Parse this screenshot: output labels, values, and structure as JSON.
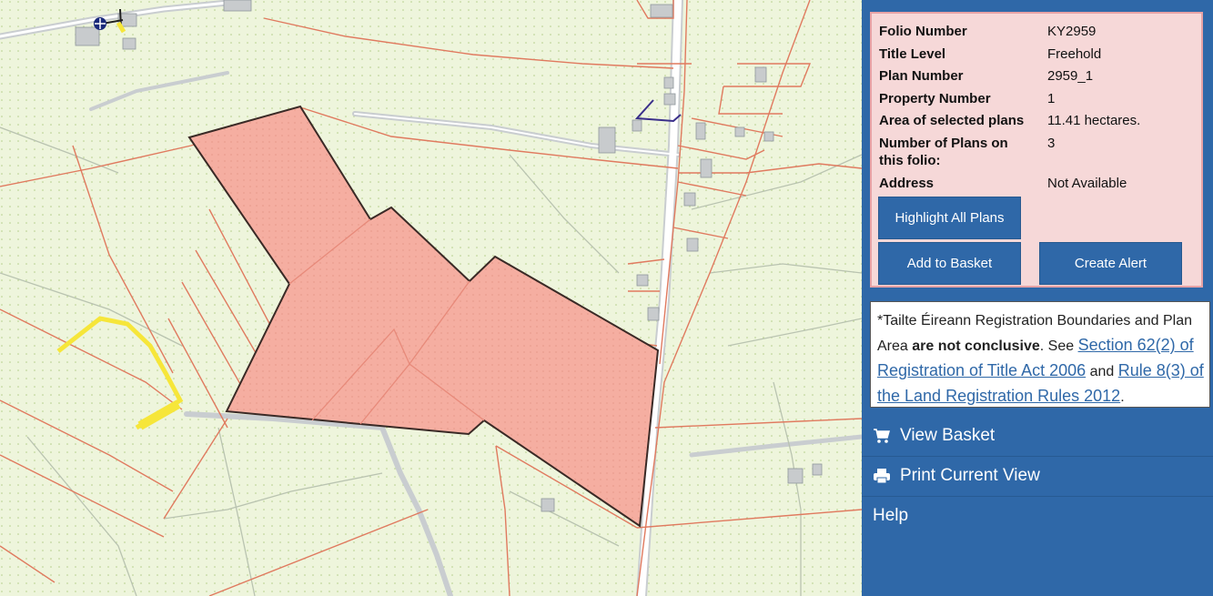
{
  "info_panel": {
    "rows": [
      {
        "label": "Folio Number",
        "value": "KY2959"
      },
      {
        "label": "Title Level",
        "value": "Freehold"
      },
      {
        "label": "Plan Number",
        "value": "2959_1"
      },
      {
        "label": "Property Number",
        "value": "1"
      },
      {
        "label": "Area of selected plans",
        "value": "11.41 hectares."
      },
      {
        "label": "Number of Plans on this folio:",
        "value": "3"
      },
      {
        "label": "Address",
        "value": "Not Available"
      }
    ],
    "buttons": {
      "highlight_all": "Highlight All Plans",
      "add_to_basket": "Add to Basket",
      "create_alert": "Create Alert"
    }
  },
  "disclaimer": {
    "lead": "*Tailte Éireann Registration Boundaries and Plan Area ",
    "bold": "are not conclusive",
    "mid1": ". See ",
    "link1": "Section 62(2) of Registration of Title Act 2006",
    "mid2": " and ",
    "link2": "Rule 8(3) of the Land Registration Rules 2012",
    "end": "."
  },
  "nav": {
    "view_basket": "View Basket",
    "print_view": "Print Current View",
    "help": "Help"
  },
  "colors": {
    "map_background": "#eef5dc",
    "parcel_fill": "#f5aea1",
    "boundary_line": "#e07a5f",
    "panel_blue": "#2f68a8",
    "info_bg": "#f6d8d8",
    "highlight_yellow": "#f6e63a"
  },
  "icons": {
    "basket": "cart-icon",
    "print": "printer-icon",
    "map_marker": "crosshair-marker-icon"
  }
}
